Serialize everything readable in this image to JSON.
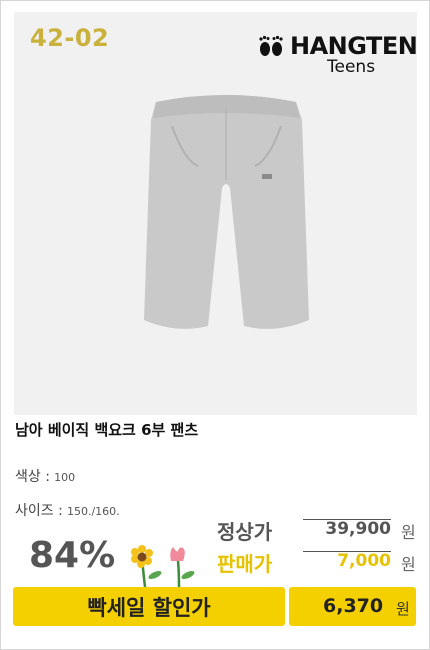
{
  "product": {
    "code": "42-02",
    "brand_name": "HANGTEN",
    "brand_sub": "Teens",
    "title": "남아 베이직 백요크 6부 팬츠"
  },
  "attributes": [
    {
      "key": "색상 :",
      "value": "100"
    },
    {
      "key": "사이즈 :",
      "value": "150./160."
    }
  ],
  "pricing": {
    "discount": "84%",
    "regular_label": "정상가",
    "regular_price": "39,900",
    "sale_label": "판매가",
    "sale_price": "7,000",
    "currency": "원"
  },
  "banner": {
    "label": "빡세일 할인가",
    "price": "6,370",
    "currency": "원"
  },
  "colors": {
    "code": "#c9b13b",
    "regular": "#555555",
    "sale": "#e6c200",
    "banner": "#f5d000"
  }
}
